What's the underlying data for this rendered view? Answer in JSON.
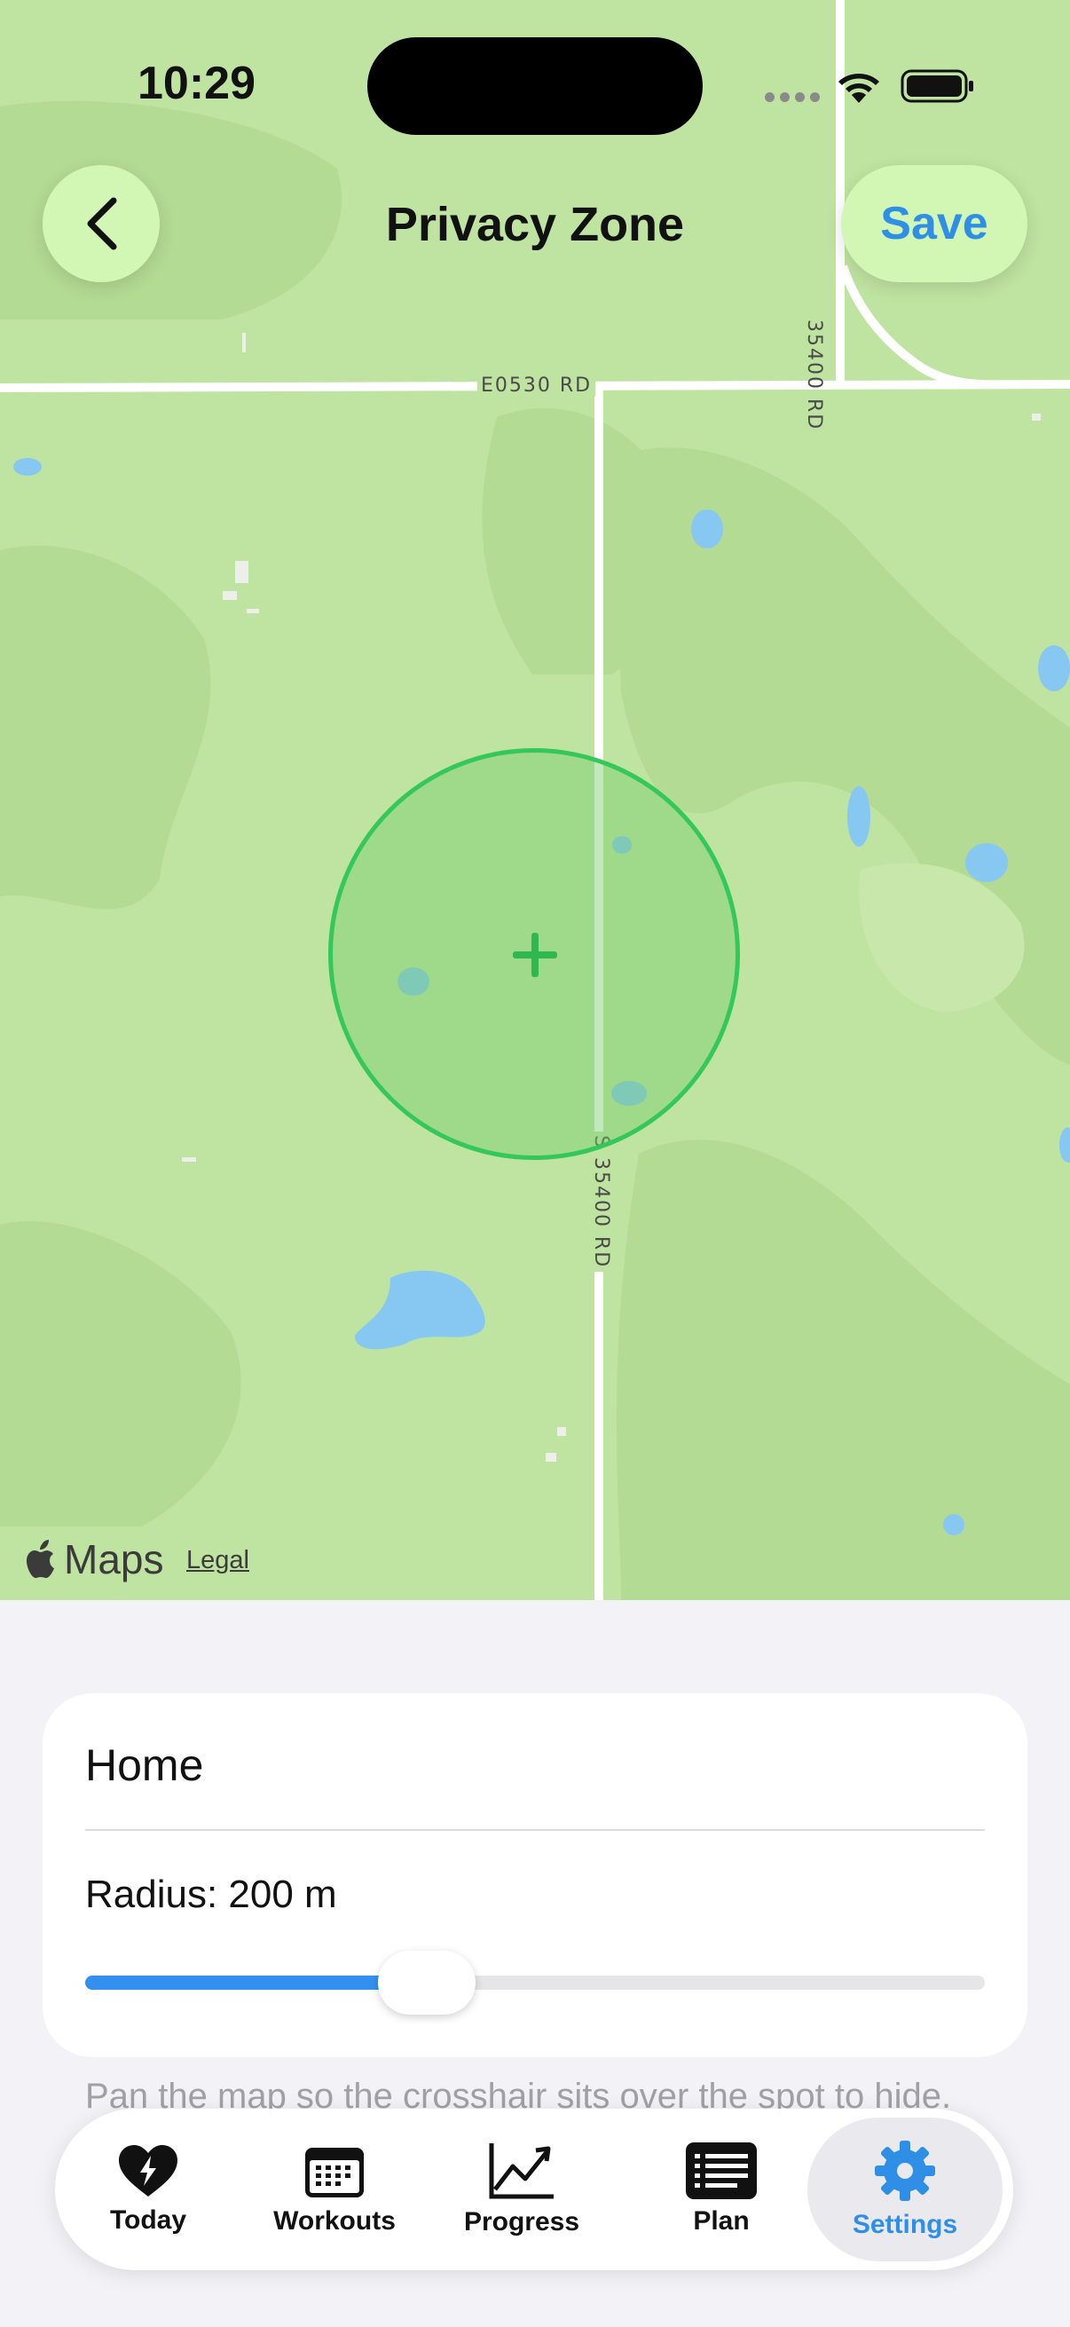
{
  "status_bar": {
    "time": "10:29"
  },
  "header": {
    "title": "Privacy Zone",
    "save_label": "Save"
  },
  "map": {
    "road_labels": [
      "E0530 RD",
      "S 35400 RD",
      "35400 RD"
    ],
    "attribution": "Maps",
    "legal": "Legal"
  },
  "zone": {
    "name": "Home",
    "radius_label": "Radius: 200 m",
    "radius_fraction": 0.38
  },
  "hint": "Pan the map so the crosshair sits over the spot to hide.",
  "tabs": [
    {
      "label": "Today",
      "icon": "heart-bolt-icon"
    },
    {
      "label": "Workouts",
      "icon": "calendar-icon"
    },
    {
      "label": "Progress",
      "icon": "chart-line-icon"
    },
    {
      "label": "Plan",
      "icon": "list-icon"
    },
    {
      "label": "Settings",
      "icon": "gear-icon",
      "active": true
    }
  ],
  "colors": {
    "accent": "#2f8fe6",
    "zone": "#34c759",
    "button_bg": "#d2f7b4"
  }
}
